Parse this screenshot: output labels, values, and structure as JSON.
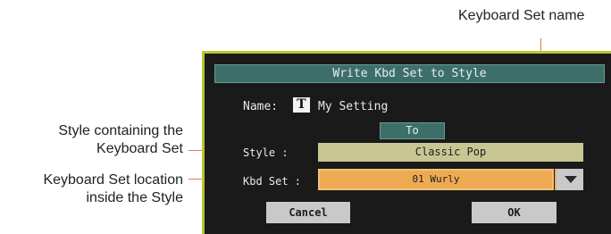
{
  "callouts": {
    "keyboard_set_name": "Keyboard Set name",
    "style_containing_line1": "Style containing the",
    "style_containing_line2": "Keyboard Set",
    "location_line1": "Keyboard Set location",
    "location_line2": "inside the Style"
  },
  "dialog": {
    "title": "Write Kbd Set to Style",
    "name_label": "Name:",
    "name_type_icon": "T",
    "name_value": "My Setting",
    "to_button": "To",
    "style_label": "Style :",
    "style_value": "Classic Pop",
    "kbd_set_label": "Kbd Set :",
    "kbd_set_value": "01 Wurly",
    "cancel_button": "Cancel",
    "ok_button": "OK"
  },
  "colors": {
    "frame_accent": "#b9c632",
    "title_bar": "#3d6f6a",
    "style_field": "#c8c793",
    "selected_field": "#eeaa52",
    "leader_line": "#e8784a"
  }
}
